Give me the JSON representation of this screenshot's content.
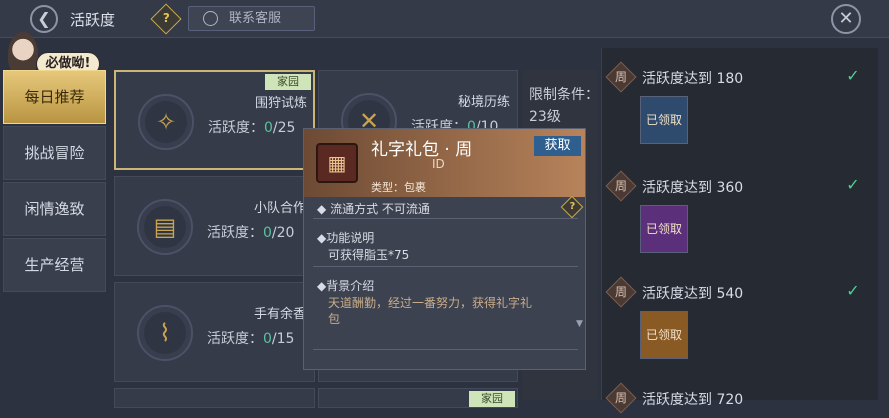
{
  "header": {
    "title": "活跃度",
    "service_label": "联系客服"
  },
  "mascot": {
    "bubble": "必做呦!"
  },
  "nav": [
    {
      "label": "每日推荐",
      "active": true
    },
    {
      "label": "挑战冒险",
      "active": false
    },
    {
      "label": "闲情逸致",
      "active": false
    },
    {
      "label": "生产经营",
      "active": false
    }
  ],
  "cards": [
    {
      "name": "围狩试炼",
      "val_label": "活跃度：",
      "cur": "0",
      "max": "/25",
      "tag": "家园"
    },
    {
      "name": "秘境历练",
      "val_label": "活跃度：",
      "cur": "0",
      "max": "/10"
    },
    {
      "name": "小队合作",
      "val_label": "活跃度：",
      "cur": "0",
      "max": "/20"
    },
    {
      "name": "手有余香",
      "val_label": "活跃度：",
      "cur": "0",
      "max": "/15"
    },
    {
      "tag": "家园"
    }
  ],
  "condition": {
    "label": "限制条件：",
    "value": "23级"
  },
  "rewards": [
    {
      "badge": "周",
      "text": "活跃度达到 180",
      "chest": "已领取",
      "color": "#2e4b6e"
    },
    {
      "badge": "周",
      "text": "活跃度达到 360",
      "chest": "已领取",
      "color": "#5b2f7a"
    },
    {
      "badge": "周",
      "text": "活跃度达到 540",
      "chest": "已领取",
      "color": "#8a5a24"
    },
    {
      "badge": "周",
      "text": "活跃度达到 720"
    }
  ],
  "popup": {
    "title": "礼字礼包 · 周",
    "id": "ID",
    "type": "类型：包裹",
    "get": "获取",
    "circulation": "流通方式    不可流通",
    "func_title": "功能说明",
    "func_text": "可获得脂玉*75",
    "bg_title": "背景介绍",
    "bg_text1": "天道酬勤，经过一番努力，获得礼字礼",
    "bg_text2": "包"
  }
}
